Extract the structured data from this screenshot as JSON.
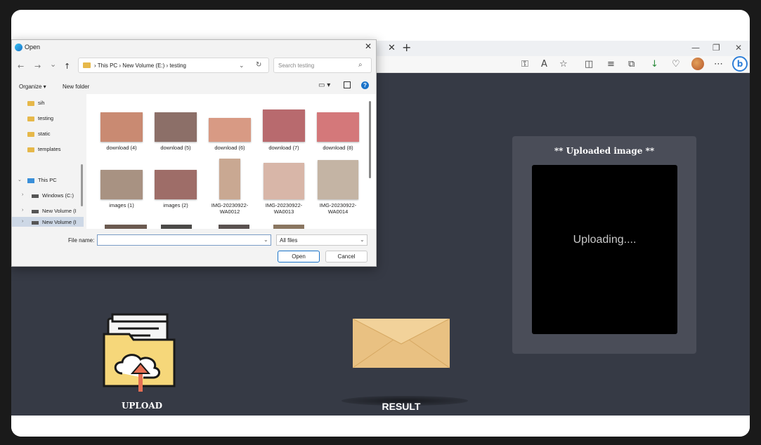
{
  "browser": {
    "tab_close": "✕",
    "tab_new": "+",
    "window_controls": [
      "—",
      "❐",
      "✕"
    ],
    "toolbar_icons": [
      "key-icon",
      "read-aloud-icon",
      "favorite-star-icon",
      "split-screen-icon",
      "favorites-list-icon",
      "collections-icon",
      "downloads-icon",
      "heart-shield-icon",
      "profile-avatar",
      "more-icon",
      "bing-icon"
    ],
    "toolbar_glyphs": [
      "⚿",
      "A",
      "☆",
      "◫",
      "≡",
      "⧉",
      "↓",
      "♡",
      "",
      "⋯"
    ],
    "bing_label": "b"
  },
  "page": {
    "upload_card_title": "** Uploaded image **",
    "uploading_text": "Uploading....",
    "upload_label": "UPLOAD",
    "result_label": "RESULT"
  },
  "dialog": {
    "title": "Open",
    "close": "✕",
    "nav": {
      "back": "←",
      "forward": "→",
      "recent": "⌄",
      "up": "↑"
    },
    "address": {
      "crumbs": "›  This PC  ›  New Volume (E:)  ›  testing",
      "dropdown": "⌄",
      "refresh": "↻"
    },
    "search_placeholder": "Search testing",
    "search_icon": "⌕",
    "organize": "Organize ▾",
    "new_folder": "New folder",
    "view_icon": "▭ ▾",
    "help": "?",
    "nav_items": [
      {
        "label": "sih",
        "kind": "folder"
      },
      {
        "label": "testing",
        "kind": "folder"
      },
      {
        "label": "static",
        "kind": "folder"
      },
      {
        "label": "templates",
        "kind": "folder"
      },
      {
        "label": "This PC",
        "kind": "pc"
      },
      {
        "label": "Windows (C:)",
        "kind": "drive"
      },
      {
        "label": "New Volume (I",
        "kind": "drive"
      },
      {
        "label": "New Volume (I",
        "kind": "drive"
      }
    ],
    "files": [
      {
        "name": "download (4)",
        "color": "#c98a72"
      },
      {
        "name": "download (5)",
        "color": "#8c6f68"
      },
      {
        "name": "download (6)",
        "color": "#d89a84"
      },
      {
        "name": "download (7)",
        "color": "#b86a6e"
      },
      {
        "name": "download (8)",
        "color": "#d4787a"
      },
      {
        "name": "images (1)",
        "color": "#a89282"
      },
      {
        "name": "images (2)",
        "color": "#9e6d68"
      },
      {
        "name": "IMG-20230922-WA0012",
        "color": "#c9a892"
      },
      {
        "name": "IMG-20230922-WA0013",
        "color": "#d8b6a8"
      },
      {
        "name": "IMG-20230922-WA0014",
        "color": "#c4b4a4"
      }
    ],
    "file_name_label": "File name:",
    "file_name_value": "",
    "file_type": "All files",
    "open_button": "Open",
    "cancel_button": "Cancel"
  }
}
